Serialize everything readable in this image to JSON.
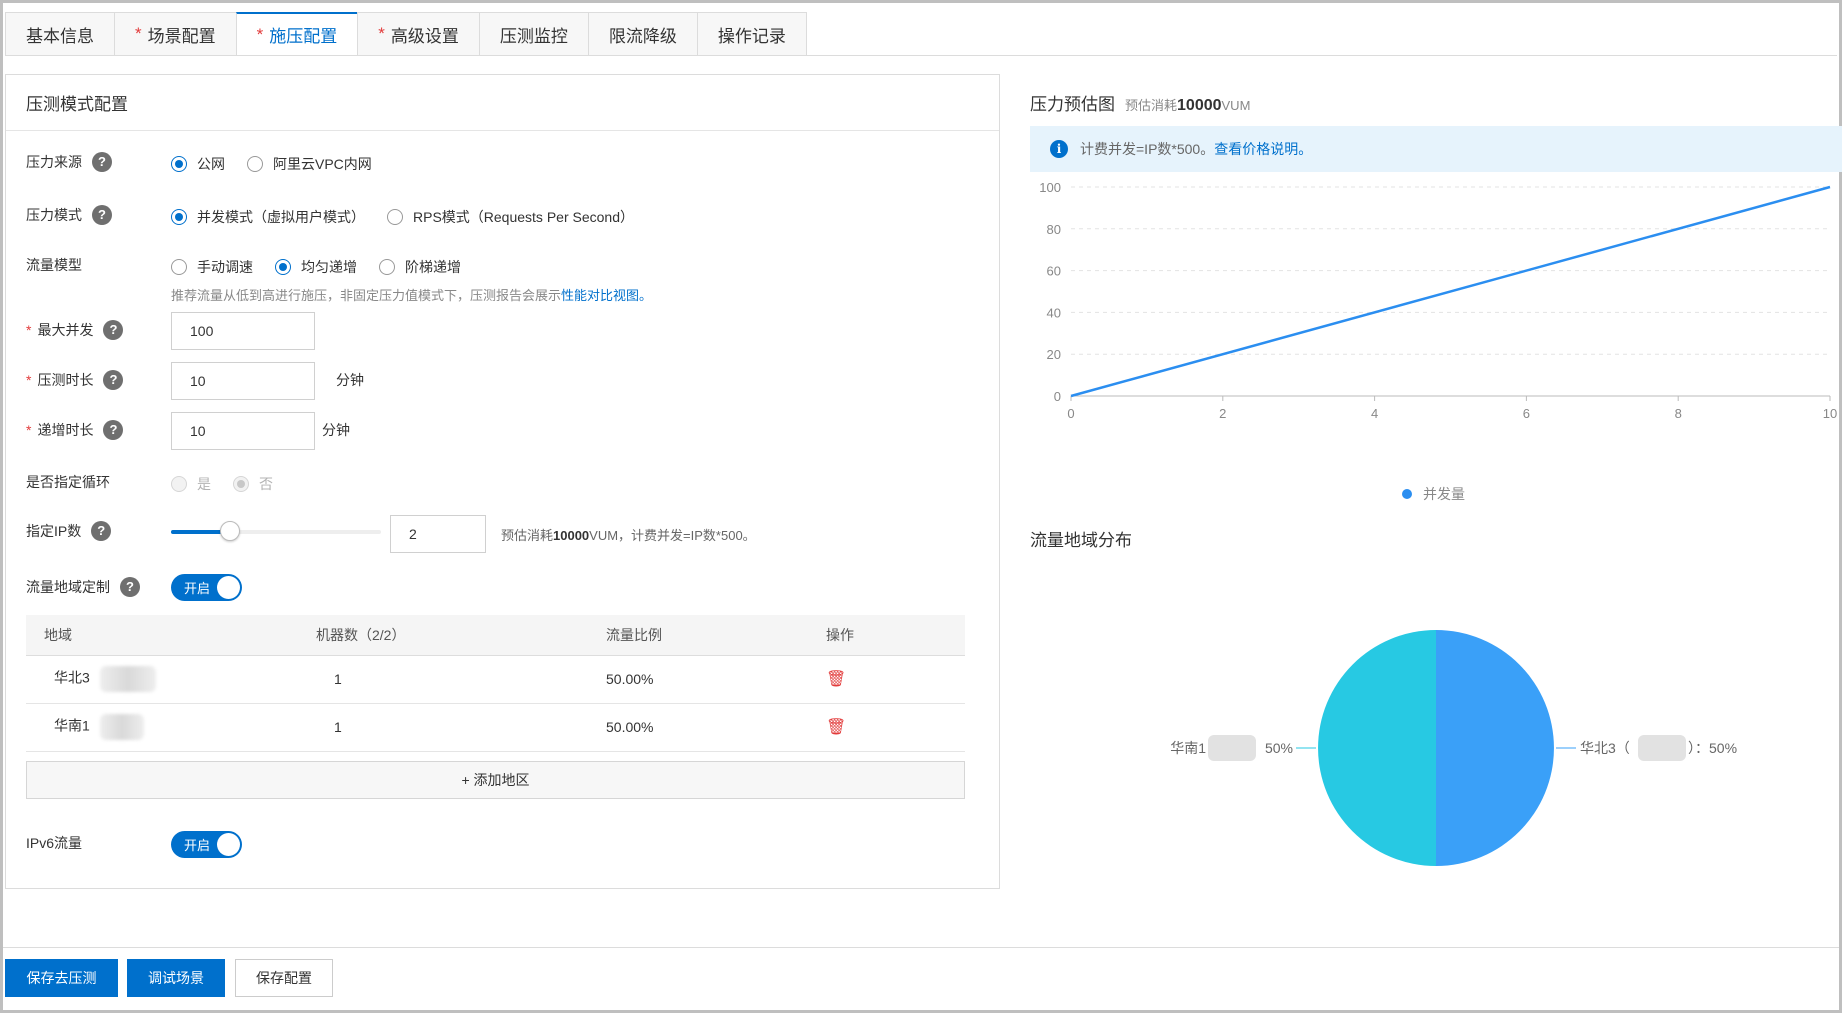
{
  "tabs": [
    {
      "label": "基本信息",
      "required": false,
      "active": false
    },
    {
      "label": "场景配置",
      "required": true,
      "active": false
    },
    {
      "label": "施压配置",
      "required": true,
      "active": true
    },
    {
      "label": "高级设置",
      "required": true,
      "active": false
    },
    {
      "label": "压测监控",
      "required": false,
      "active": false
    },
    {
      "label": "限流降级",
      "required": false,
      "active": false
    },
    {
      "label": "操作记录",
      "required": false,
      "active": false
    }
  ],
  "required_mark": "*",
  "panel": {
    "title": "压测模式配置",
    "pressure_source": {
      "label": "压力来源",
      "options": [
        "公网",
        "阿里云VPC内网"
      ],
      "selected": "公网"
    },
    "pressure_mode": {
      "label": "压力模式",
      "options": [
        "并发模式（虚拟用户模式）",
        "RPS模式（Requests Per Second）"
      ],
      "selected": "并发模式（虚拟用户模式）"
    },
    "traffic_model": {
      "label": "流量模型",
      "options": [
        "手动调速",
        "均匀递增",
        "阶梯递增"
      ],
      "selected": "均匀递增",
      "hint": "推荐流量从低到高进行施压，非固定压力值模式下，压测报告会展示",
      "hint_link": "性能对比视图。"
    },
    "max_concurrency": {
      "label": "最大并发",
      "value": "100"
    },
    "duration": {
      "label": "压测时长",
      "value": "10",
      "unit": "分钟"
    },
    "ramp_duration": {
      "label": "递增时长",
      "value": "10",
      "unit": "分钟"
    },
    "loop": {
      "label": "是否指定循环",
      "options": [
        "是",
        "否"
      ],
      "selected": "否"
    },
    "ip_count": {
      "label": "指定IP数",
      "value": "2",
      "slider_fraction": 0.28,
      "note_prefix": "预估消耗",
      "note_bold": "10000",
      "note_suffix": "VUM，计费并发=IP数*500。"
    },
    "region_custom": {
      "label": "流量地域定制",
      "toggle": "开启"
    },
    "region_table": {
      "headers": [
        "地域",
        "机器数（2/2）",
        "流量比例",
        "操作"
      ],
      "rows": [
        {
          "region": "华北3",
          "machines": "1",
          "ratio": "50.00%"
        },
        {
          "region": "华南1",
          "machines": "1",
          "ratio": "50.00%"
        }
      ],
      "add_label": "+ 添加地区"
    },
    "ipv6": {
      "label": "IPv6流量",
      "toggle": "开启"
    }
  },
  "estimate_chart": {
    "title": "压力预估图",
    "sub_prefix": "预估消耗",
    "sub_bold": "10000",
    "sub_suffix": "VUM",
    "info_text": "计费并发=IP数*500。",
    "info_link": "查看价格说明。",
    "legend": "并发量"
  },
  "chart_data": [
    {
      "type": "line",
      "title": "压力预估图",
      "x": [
        0,
        10
      ],
      "series": [
        {
          "name": "并发量",
          "values": [
            0,
            100
          ]
        }
      ],
      "xticks": [
        0,
        2,
        4,
        6,
        8,
        10
      ],
      "yticks": [
        0,
        20,
        40,
        60,
        80,
        100
      ],
      "xlim": [
        0,
        10
      ],
      "ylim": [
        0,
        100
      ],
      "grid": true,
      "legend": "bottom-center",
      "color": "#2b8ef0"
    },
    {
      "type": "pie",
      "title": "流量地域分布",
      "slices": [
        {
          "label": "华北3",
          "label_open": "（",
          "label_close": "）：50%",
          "value": 50,
          "color": "#3aa0f8"
        },
        {
          "label": "华南1",
          "label_suffix": "50%",
          "value": 50,
          "color": "#27c9e3"
        }
      ]
    }
  ],
  "region_chart": {
    "title": "流量地域分布"
  },
  "buttons": {
    "save_test": "保存去压测",
    "debug": "调试场景",
    "save": "保存配置"
  },
  "colors": {
    "primary": "#0070cc",
    "danger": "#e23b3b",
    "info_bg": "#e6f3fc"
  }
}
